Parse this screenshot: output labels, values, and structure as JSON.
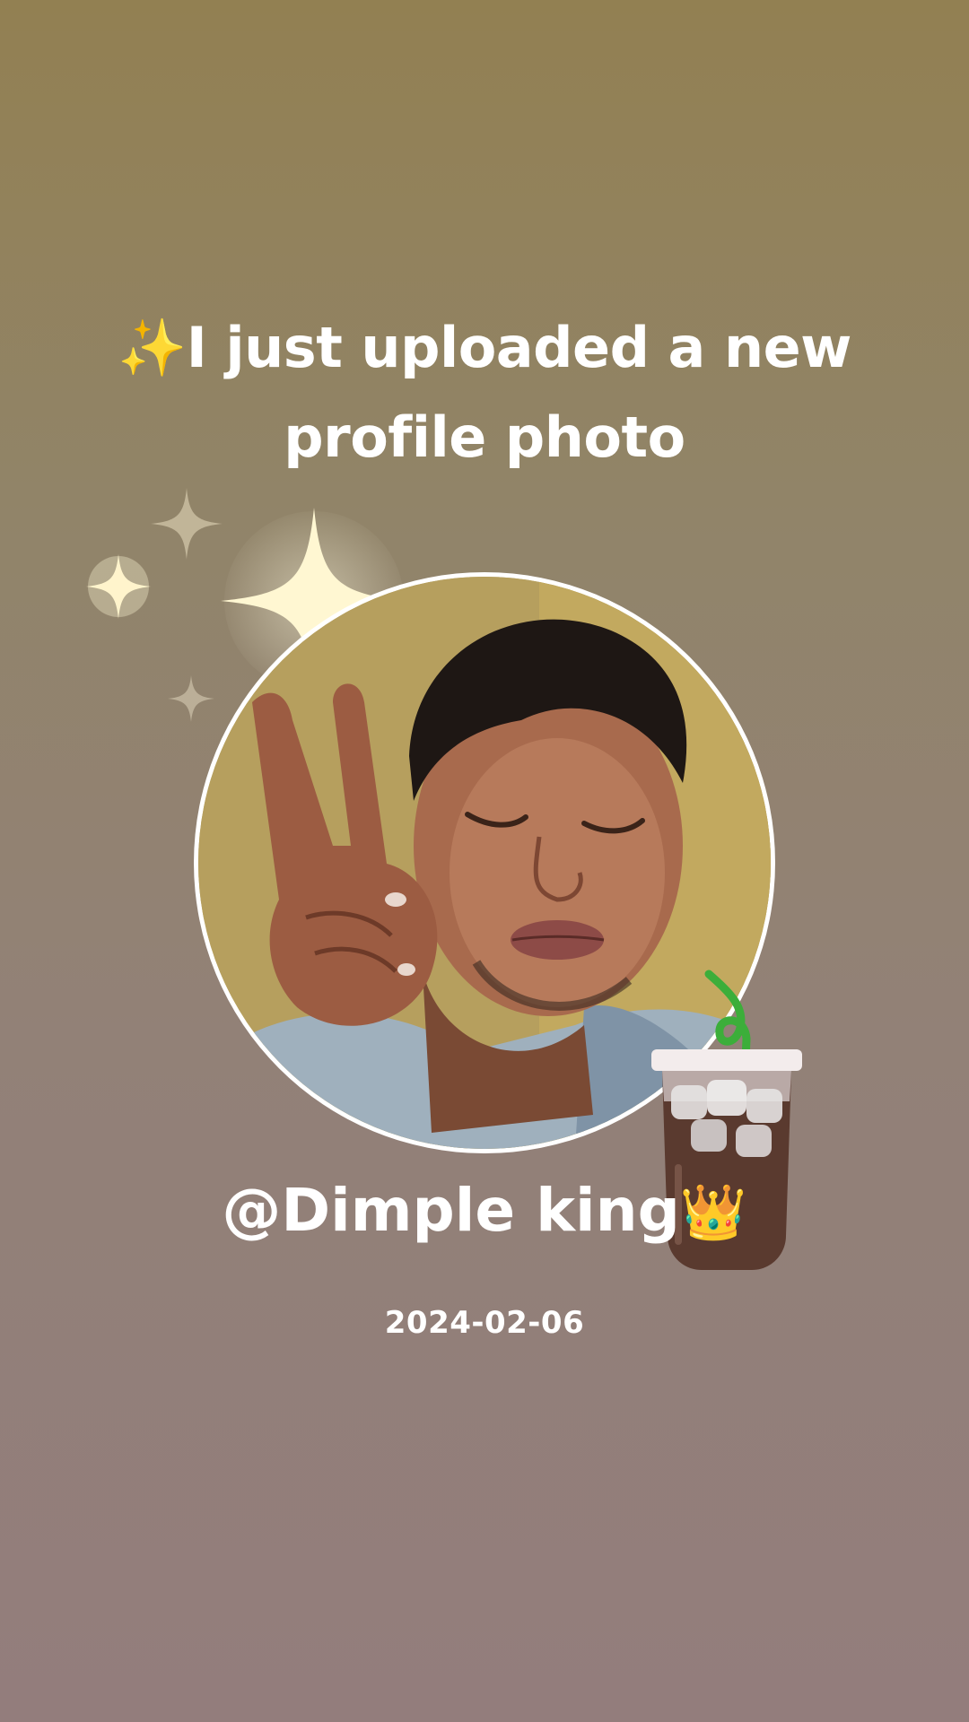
{
  "headline": {
    "emoji": "✨",
    "text": "I just uploaded a new profile photo"
  },
  "profile": {
    "username": "@Dimple king",
    "username_emoji": "👑",
    "date": "2024-02-06"
  },
  "colors": {
    "background_top": "#928052",
    "background_bottom": "#937d7c",
    "text": "#ffffff",
    "avatar_ring": "#ffffff",
    "sparkle": "#fff4c8"
  },
  "icons": {
    "headline_icon": "sparkles-icon",
    "username_icon": "crown-icon",
    "sticker": "iced-drink-sticker"
  }
}
